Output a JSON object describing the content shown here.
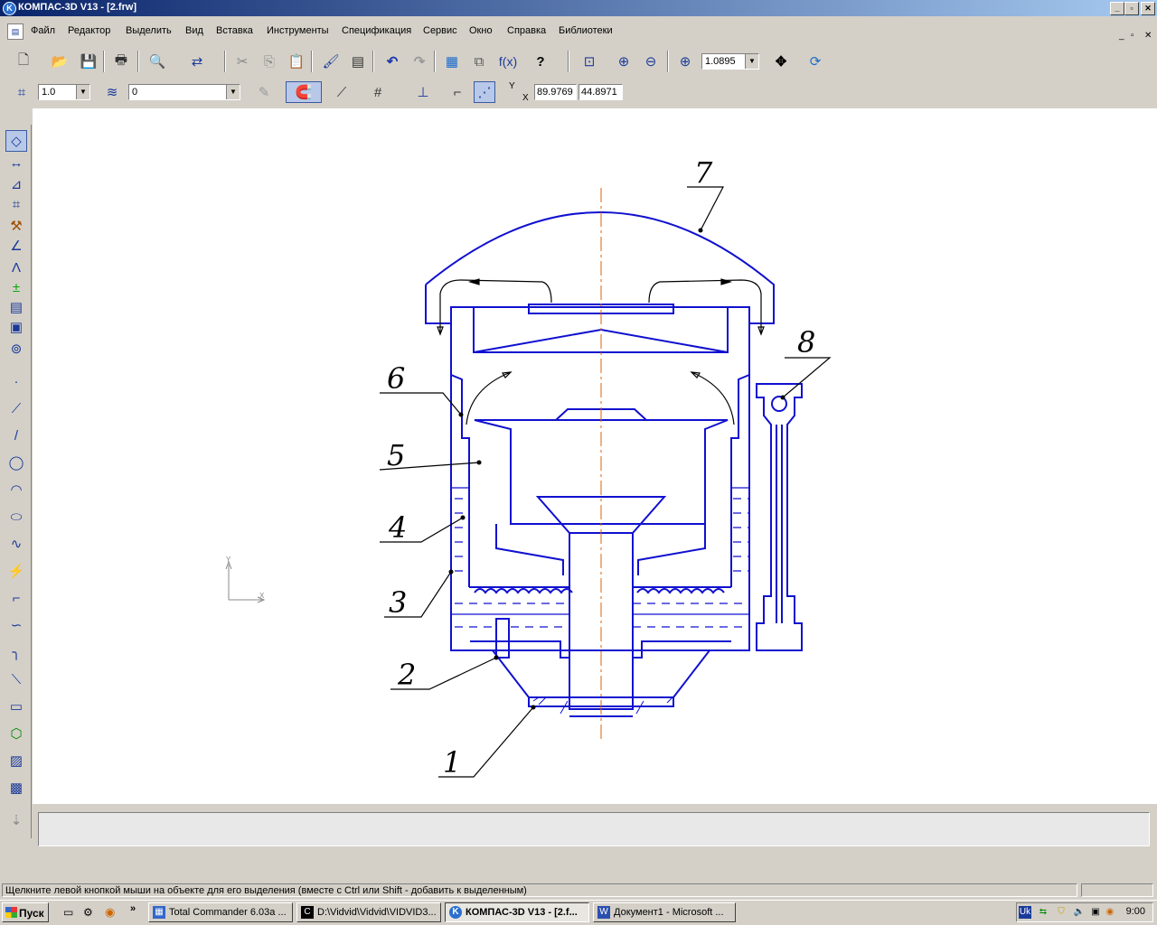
{
  "window": {
    "title": "КОМПАС-3D V13 - [2.frw]",
    "app_icon": "kompas-logo-icon"
  },
  "menu": {
    "items": [
      "Файл",
      "Редактор",
      "Выделить",
      "Вид",
      "Вставка",
      "Инструменты",
      "Спецификация",
      "Сервис",
      "Окно",
      "Справка",
      "Библиотеки"
    ]
  },
  "toolbar_main": {
    "zoom_value": "1.0895",
    "icons": [
      "new-document-icon",
      "open-folder-icon",
      "save-icon",
      "print-icon",
      "print-preview-icon",
      "insert-object-icon",
      "cut-icon",
      "copy-icon",
      "paste-icon",
      "format-brush-icon",
      "properties-icon",
      "undo-icon",
      "redo-icon",
      "manager-icon",
      "library-icon",
      "variables-icon",
      "help-pointer-icon",
      "zoom-window-icon",
      "zoom-in-icon",
      "zoom-out-icon",
      "zoom-scale-icon",
      "pan-icon",
      "refresh-icon"
    ]
  },
  "toolbar_current": {
    "step_value": "1.0",
    "layer_value": "0",
    "coord_x_label": "Y",
    "coord_y_label": "X",
    "coord_x": "89.9769",
    "coord_y": "44.8971"
  },
  "left_toolbar": {
    "icons": [
      "geometry-icon",
      "dimensions-icon",
      "designations-icon",
      "parametrization-icon",
      "edit-icon",
      "measure-icon",
      "select-icon",
      "associative-view-icon",
      "spec-icon",
      "report-icon",
      "insert-fragment-icon",
      "point-icon",
      "line-icon",
      "segment-icon",
      "circle-icon",
      "arc-icon",
      "ellipse-icon",
      "spline-icon",
      "nurbs-icon",
      "polyline-icon",
      "bezier-icon",
      "fillet-icon",
      "chamfer-icon",
      "rectangle-icon",
      "polygon-icon",
      "hatch-icon",
      "fill-icon"
    ]
  },
  "drawing": {
    "leader_labels": [
      "1",
      "2",
      "3",
      "4",
      "5",
      "6",
      "7",
      "8"
    ],
    "axis_y": "Y",
    "axis_x": "X"
  },
  "status_bar": {
    "message": "Щелкните левой кнопкой мыши на объекте для его выделения (вместе с Ctrl или Shift - добавить к выделенным)"
  },
  "taskbar": {
    "start_label": "Пуск",
    "tasks": [
      {
        "label": "Total Commander 6.03a ...",
        "icon": "total-commander-icon",
        "active": false
      },
      {
        "label": "D:\\Vidvid\\Vidvid\\VIDVID3...",
        "icon": "console-icon",
        "active": false
      },
      {
        "label": "КОМПАС-3D V13 - [2.f...",
        "icon": "kompas-icon",
        "active": true
      },
      {
        "label": "Документ1 - Microsoft ...",
        "icon": "word-icon",
        "active": false
      }
    ],
    "clock": "9:00",
    "language": "Uk"
  }
}
